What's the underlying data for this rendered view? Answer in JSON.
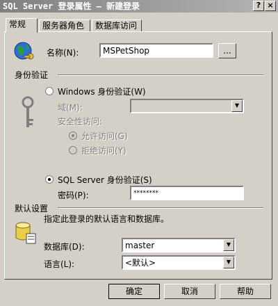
{
  "window": {
    "title": "SQL Server 登录属性 — 新建登录",
    "help_glyph": "?",
    "close_glyph": "×"
  },
  "tabs": [
    {
      "label": "常规"
    },
    {
      "label": "服务器角色"
    },
    {
      "label": "数据库访问"
    }
  ],
  "name": {
    "label": "名称(N):",
    "value": "MSPetShop",
    "browse_label": "..."
  },
  "auth": {
    "section_label": "身份验证",
    "windows_label": "Windows 身份验证(W)",
    "domain_label": "域(M):",
    "security_access_label": "安全性访问:",
    "allow_label": "允许访问(G)",
    "deny_label": "拒绝访问(Y)",
    "sql_label": "SQL Server 身份验证(S)",
    "password_label": "密码(P):",
    "password_value": "********"
  },
  "defaults": {
    "section_label": "默认设置",
    "description": "指定此登录的默认语言和数据库。",
    "database_label": "数据库(D):",
    "database_value": "master",
    "language_label": "语言(L):",
    "language_value": "<默认>"
  },
  "buttons": {
    "ok": "确定",
    "cancel": "取消",
    "help": "帮助"
  }
}
